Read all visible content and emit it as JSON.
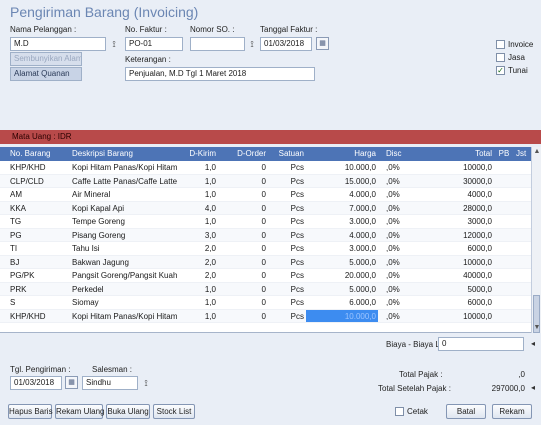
{
  "window": {
    "title": "Pengiriman Barang (Invoicing)"
  },
  "header": {
    "pelanggan_label": "Nama Pelanggan :",
    "pelanggan_value": "M.D",
    "pelanggan_ghost": "Sembunyikan Alamat",
    "alamat_button": "Alamat Quanan",
    "faktur_label": "No. Faktur :",
    "faktur_value": "PO-01",
    "nomor_so_label": "Nomor SO. :",
    "nomor_so_value": "",
    "tanggal_label": "Tanggal Faktur :",
    "tanggal_value": "01/03/2018",
    "keterangan_label": "Keterangan :",
    "keterangan_value": "Penjualan, M.D Tgl 1 Maret 2018"
  },
  "options": [
    {
      "label": "Invoice",
      "checked": false
    },
    {
      "label": "Jasa",
      "checked": false
    },
    {
      "label": "Tunai",
      "checked": true
    }
  ],
  "currency_bar": "Mata Uang : IDR",
  "table": {
    "columns": [
      "No. Barang",
      "Deskripsi Barang",
      "D-Kirim",
      "D-Order",
      "Satuan",
      "Harga",
      "Disc",
      "Total",
      "PB",
      "Jst"
    ],
    "rows": [
      [
        "KHP/KHD",
        "Kopi Hitam Panas/Kopi Hitam Din",
        "1,0",
        "0",
        "Pcs",
        "10.000,0",
        ",0%",
        "10000,0",
        "",
        ""
      ],
      [
        "CLP/CLD",
        "Caffe Latte Panas/Caffe Latte D",
        "1,0",
        "0",
        "Pcs",
        "15.000,0",
        ",0%",
        "30000,0",
        "",
        ""
      ],
      [
        "AM",
        "Air Mineral",
        "1,0",
        "0",
        "Pcs",
        "4.000,0",
        ",0%",
        "4000,0",
        "",
        ""
      ],
      [
        "KKA",
        "Kopi Kapal Api",
        "4,0",
        "0",
        "Pcs",
        "7.000,0",
        ",0%",
        "28000,0",
        "",
        ""
      ],
      [
        "TG",
        "Tempe Goreng",
        "1,0",
        "0",
        "Pcs",
        "3.000,0",
        ",0%",
        "3000,0",
        "",
        ""
      ],
      [
        "PG",
        "Pisang Goreng",
        "3,0",
        "0",
        "Pcs",
        "4.000,0",
        ",0%",
        "12000,0",
        "",
        ""
      ],
      [
        "TI",
        "Tahu Isi",
        "2,0",
        "0",
        "Pcs",
        "3.000,0",
        ",0%",
        "6000,0",
        "",
        ""
      ],
      [
        "BJ",
        "Bakwan Jagung",
        "2,0",
        "0",
        "Pcs",
        "5.000,0",
        ",0%",
        "10000,0",
        "",
        ""
      ],
      [
        "PG/PK",
        "Pangsit Goreng/Pangsit Kuah",
        "2,0",
        "0",
        "Pcs",
        "20.000,0",
        ",0%",
        "40000,0",
        "",
        ""
      ],
      [
        "PRK",
        "Perkedel",
        "1,0",
        "0",
        "Pcs",
        "5.000,0",
        ",0%",
        "5000,0",
        "",
        ""
      ],
      [
        "S",
        "Siomay",
        "1,0",
        "0",
        "Pcs",
        "6.000,0",
        ",0%",
        "6000,0",
        "",
        ""
      ],
      [
        "KHP/KHD",
        "Kopi Hitam Panas/Kopi Hitam Din",
        "1,0",
        "0",
        "Pcs",
        "10.000,0",
        ",0%",
        "10000,0",
        "",
        ""
      ]
    ],
    "highlight": {
      "row": 11,
      "col": 5
    }
  },
  "footer": {
    "biaya_label": "Biaya - Biaya Lain :",
    "biaya_value": "0",
    "tgl_pengiriman_label": "Tgl. Pengiriman :",
    "tgl_pengiriman_value": "01/03/2018",
    "salesman_label": "Salesman :",
    "salesman_value": "Sindhu",
    "total_pajak_label": "Total Pajak :",
    "total_pajak_value": ",0",
    "total_setelah_label": "Total Setelah Pajak :",
    "total_setelah_value": "297000,0"
  },
  "buttons": {
    "hapus_baris": "Hapus Baris",
    "rekam_ulang": "Rekam Ulang",
    "buka_ulang": "Buka Ulang",
    "stock_list": "Stock List",
    "cetak": "Cetak",
    "batal": "Batal",
    "rekam": "Rekam"
  },
  "icons": {
    "lookup": "lookup-icon",
    "calendar": "calendar-icon",
    "scroll_up": "scroll-up-icon",
    "scroll_down": "scroll-down-icon",
    "edge_marker": "edge-marker-icon"
  },
  "colors": {
    "background": "#e9eef6",
    "header_row": "#4d74b6",
    "currency_bar": "#b84a4a",
    "highlight_cell": "#3d8cf0",
    "title": "#6b86b3"
  }
}
